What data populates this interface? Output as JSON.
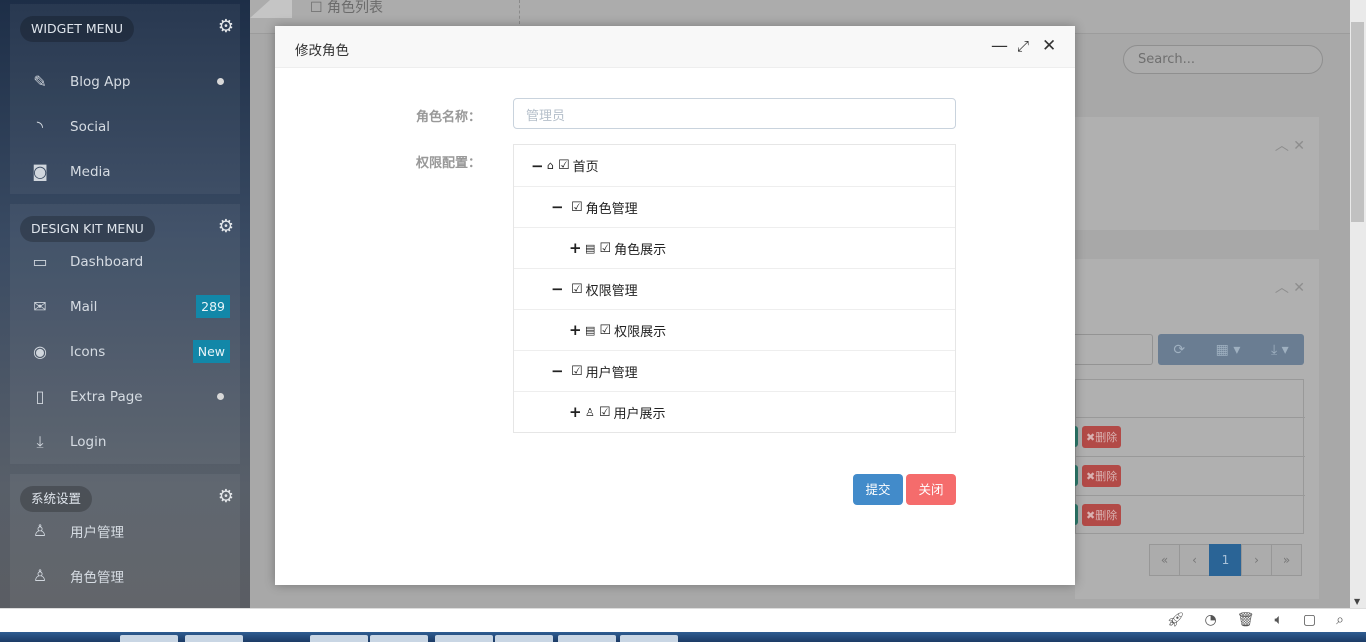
{
  "sidebar": {
    "widget_menu": {
      "title": "WIDGET MENU",
      "items": [
        {
          "label": "Blog App",
          "icon": "edit-icon",
          "dot": true
        },
        {
          "label": "Social",
          "icon": "rss-icon"
        },
        {
          "label": "Media",
          "icon": "camera-icon"
        }
      ]
    },
    "design_kit_menu": {
      "title": "DESIGN KIT MENU",
      "items": [
        {
          "label": "Dashboard",
          "icon": "calendar-icon"
        },
        {
          "label": "Mail",
          "icon": "mail-icon",
          "badge": "289"
        },
        {
          "label": "Icons",
          "icon": "eye-icon",
          "badge": "New"
        },
        {
          "label": "Extra Page",
          "icon": "file-icon",
          "dot": true
        },
        {
          "label": "Login",
          "icon": "download-icon"
        }
      ]
    },
    "system_settings": {
      "title": "系统设置",
      "items": [
        {
          "label": "用户管理",
          "icon": "user-icon"
        },
        {
          "label": "角色管理",
          "icon": "users-icon"
        }
      ]
    }
  },
  "page": {
    "tab": "角色列表",
    "search_placeholder": "Search...",
    "delete_label": "删除",
    "pagination": [
      "«",
      "‹",
      "1",
      "›",
      "»"
    ],
    "current_page": "1"
  },
  "modal": {
    "title": "修改角色",
    "role_name_label": "角色名称：",
    "role_name_placeholder": "管理员",
    "permission_label": "权限配置：",
    "tree": [
      {
        "toggle": "−",
        "icon": "home-icon",
        "glyph": "⌂",
        "label": "首页",
        "checked": true,
        "level": 0
      },
      {
        "toggle": "−",
        "label": "角色管理",
        "checked": true,
        "level": 1
      },
      {
        "toggle": "+",
        "icon": "list-icon",
        "glyph": "▤",
        "label": "角色展示",
        "checked": true,
        "level": 2
      },
      {
        "toggle": "−",
        "label": "权限管理",
        "checked": true,
        "level": 1
      },
      {
        "toggle": "+",
        "icon": "list-icon",
        "glyph": "▤",
        "label": "权限展示",
        "checked": true,
        "level": 2
      },
      {
        "toggle": "−",
        "label": "用户管理",
        "checked": true,
        "level": 1
      },
      {
        "toggle": "+",
        "icon": "user-icon",
        "glyph": "♙",
        "label": "用户展示",
        "checked": true,
        "level": 2
      }
    ],
    "submit_label": "提交",
    "close_label": "关闭",
    "colors": {
      "submit": "#428bca",
      "close": "#f56c6c"
    }
  }
}
